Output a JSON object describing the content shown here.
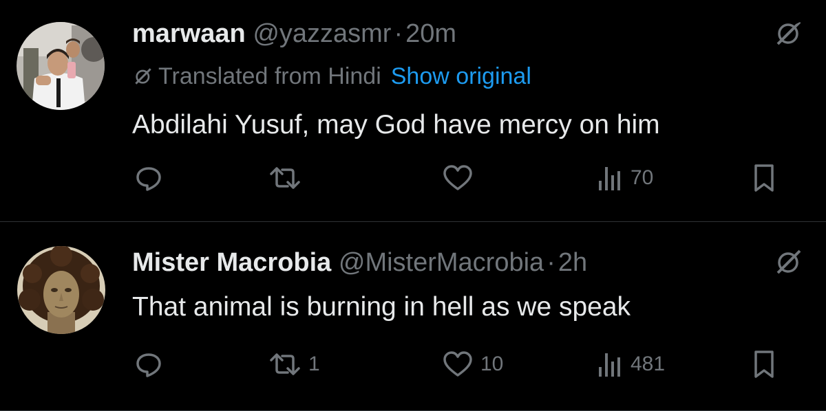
{
  "colors": {
    "background": "#000000",
    "text": "#e7e9ea",
    "muted": "#71767b",
    "link": "#1d9bf0",
    "divider": "#2f3336"
  },
  "tweets": [
    {
      "name": "marwaan",
      "handle": "@yazzasmr",
      "separator": "·",
      "time": "20m",
      "translated_label": "Translated from Hindi",
      "show_original": "Show original",
      "text": "Abdilahi Yusuf, may God have mercy on him",
      "replies": "",
      "retweets": "",
      "likes": "",
      "views": "70",
      "icons": [
        "avatar",
        "grok-icon",
        "reply-icon",
        "retweet-icon",
        "like-icon",
        "views-icon",
        "bookmark-icon"
      ]
    },
    {
      "name": "Mister Macrobia",
      "handle": "@MisterMacrobia",
      "separator": "·",
      "time": "2h",
      "text": "That animal is burning in hell as we speak",
      "replies": "",
      "retweets": "1",
      "likes": "10",
      "views": "481",
      "icons": [
        "avatar",
        "grok-icon",
        "reply-icon",
        "retweet-icon",
        "like-icon",
        "views-icon",
        "bookmark-icon"
      ]
    }
  ]
}
